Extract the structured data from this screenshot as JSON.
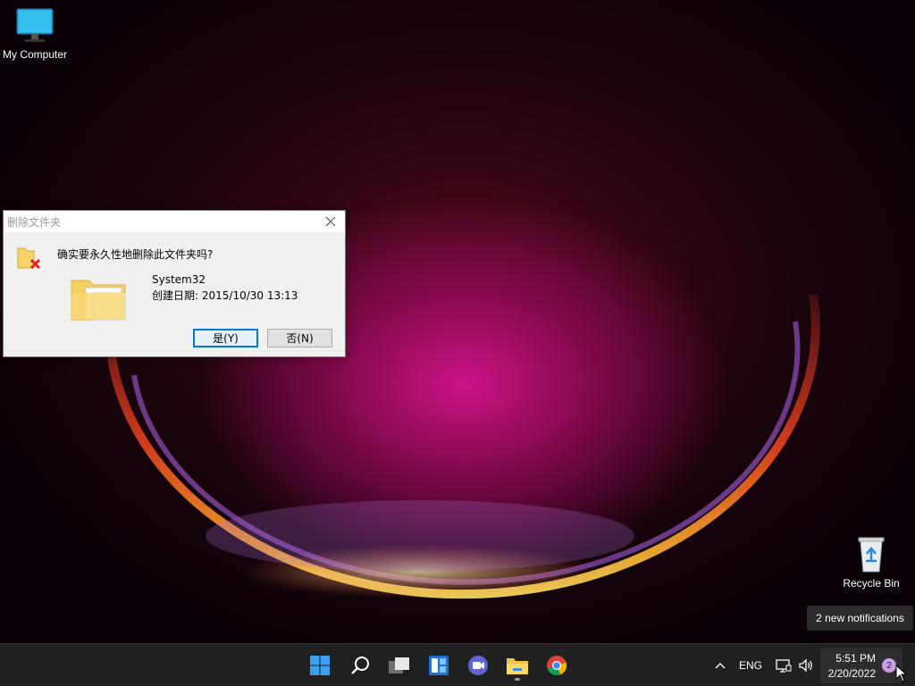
{
  "desktop": {
    "icons": [
      {
        "label": "My Computer",
        "icon": "monitor-icon"
      },
      {
        "label": "Recycle Bin",
        "icon": "recycle-bin-icon"
      }
    ]
  },
  "dialog": {
    "title": "删除文件夹",
    "question": "确实要永久性地删除此文件夹吗?",
    "file_name": "System32",
    "file_date": "创建日期: 2015/10/30 13:13",
    "yes_label": "是(Y)",
    "no_label": "否(N)"
  },
  "toast": {
    "text": "2 new notifications"
  },
  "taskbar": {
    "apps": [
      "windows-start-icon",
      "search-icon",
      "task-view-icon",
      "widgets-icon",
      "teams-chat-icon",
      "file-explorer-icon",
      "chrome-icon"
    ],
    "tray": {
      "language": "ENG"
    },
    "clock": {
      "time": "5:51 PM",
      "date": "2/20/2022",
      "notification_count": "2"
    }
  },
  "colors": {
    "accent": "#0078d7",
    "taskbar": "#202020"
  }
}
